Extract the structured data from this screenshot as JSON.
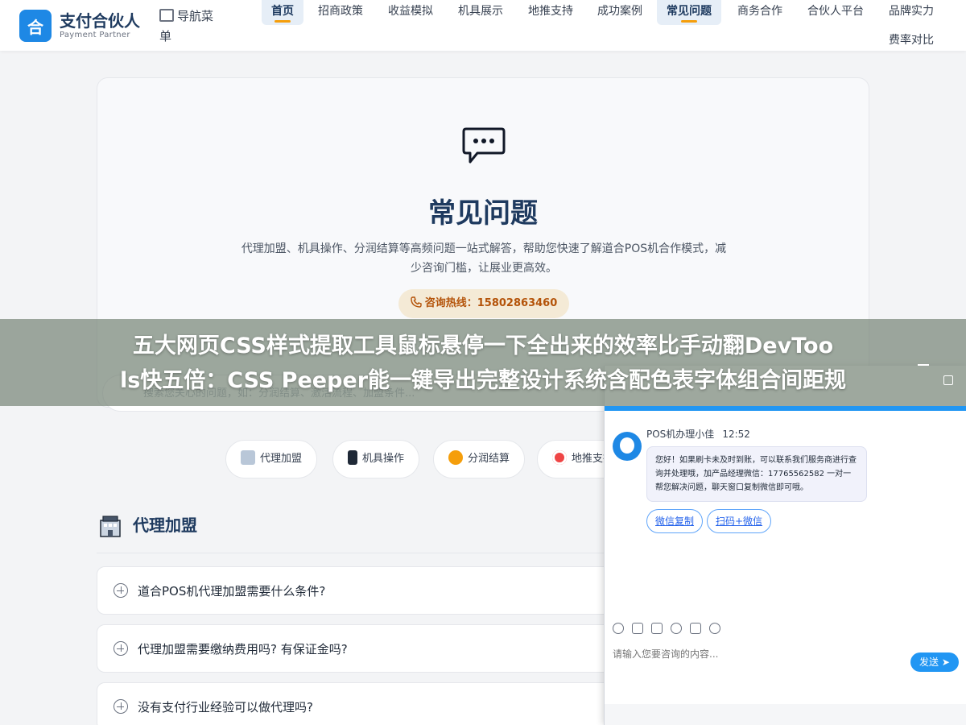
{
  "brand": {
    "name": "支付合伙人",
    "sub": "Payment Partner",
    "badge": "合"
  },
  "navmenu": {
    "label": "导航菜单"
  },
  "nav": [
    {
      "label": "首页",
      "active": true
    },
    {
      "label": "招商政策"
    },
    {
      "label": "收益模拟"
    },
    {
      "label": "机具展示"
    },
    {
      "label": "地推支持"
    },
    {
      "label": "成功案例"
    },
    {
      "label": "常见问题",
      "active": true
    },
    {
      "label": "商务合作"
    },
    {
      "label": "合伙人平台"
    },
    {
      "label": "品牌实力"
    },
    {
      "label": "费率对比"
    }
  ],
  "hero": {
    "title": "常见问题",
    "desc": "代理加盟、机具操作、分润结算等高频问题一站式解答，帮助您快速了解道合POS机合作模式，减少咨询门槛，让展业更高效。",
    "hotline_label": "咨询热线：",
    "hotline_number": "15802863460",
    "search_placeholder": "搜索您关心的问题，如：分润结算、激活流程、加盟条件..."
  },
  "categories": [
    {
      "label": "代理加盟",
      "icon": "building-icon"
    },
    {
      "label": "机具操作",
      "icon": "phone-icon"
    },
    {
      "label": "分润结算",
      "icon": "money-bag-icon"
    },
    {
      "label": "地推支持",
      "icon": "target-icon"
    }
  ],
  "section": {
    "title": "代理加盟"
  },
  "faqs": [
    "道合POS机代理加盟需要什么条件?",
    "代理加盟需要缴纳费用吗? 有保证金吗?",
    "没有支付行业经验可以做代理吗?"
  ],
  "banner": {
    "line1": "五大网页CSS样式提取工具鼠标悬停一下全出来的效率比手动翻DevToo",
    "line2": "ls快五倍：CSS Peeper能一键导出完整设计系统含配色表字体组合间距规"
  },
  "chat": {
    "agent_name": "POS机办理小佳",
    "time": "12:52",
    "message": "您好！如果刷卡未及时到账，可以联系我们服务商进行查询并处理哦，加产品经理微信：17765562582 一对一帮您解决问题，聊天窗口复制微信即可哦。",
    "quick_buttons": [
      "微信复制",
      "扫码+微信"
    ],
    "input_placeholder": "请输入您要咨询的内容...",
    "send_label": "发送"
  },
  "colors": {
    "brand": "#1e88e5",
    "title": "#1e3a5f",
    "accent": "#f59e0b"
  }
}
